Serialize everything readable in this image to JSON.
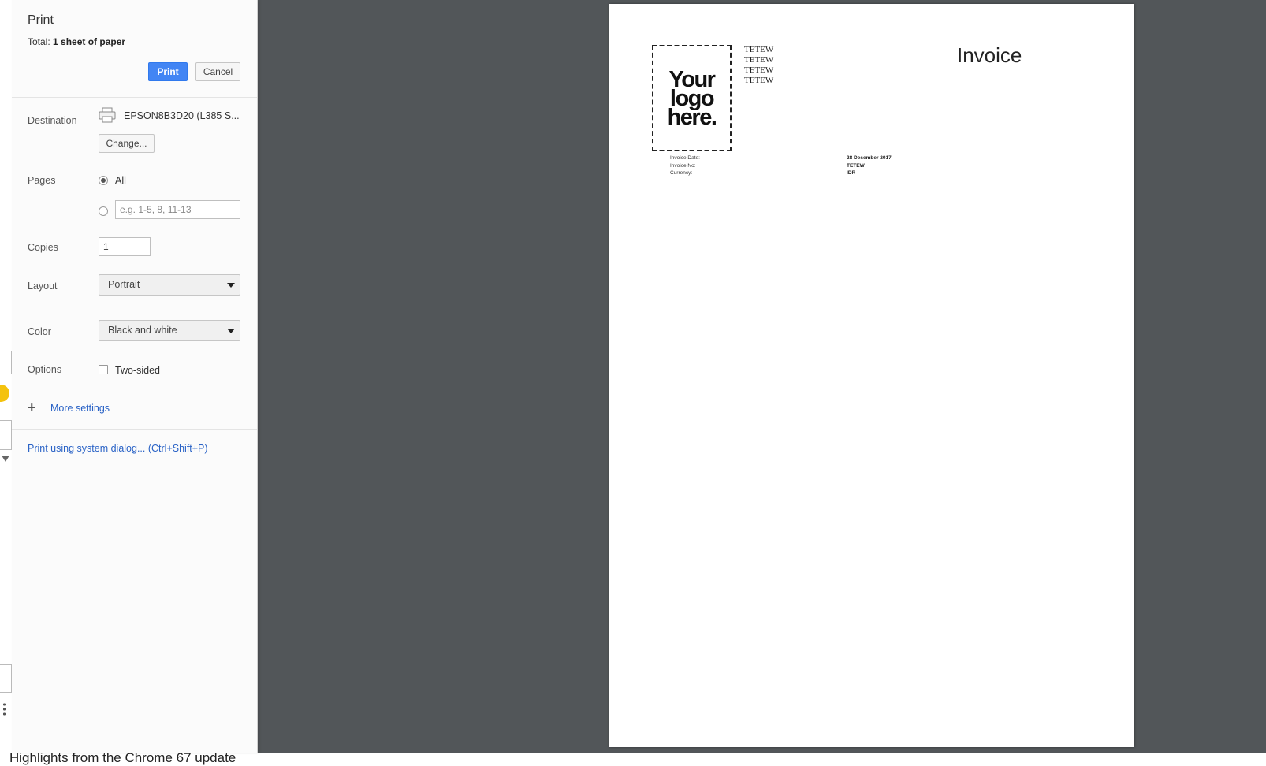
{
  "print_dialog": {
    "title": "Print",
    "total_prefix": "Total: ",
    "total_value": "1 sheet of paper",
    "print_button": "Print",
    "cancel_button": "Cancel",
    "destination": {
      "label": "Destination",
      "printer_name": "EPSON8B3D20 (L385 S...",
      "change_button": "Change..."
    },
    "pages": {
      "label": "Pages",
      "all_option": "All",
      "all_selected": true,
      "range_placeholder": "e.g. 1-5, 8, 11-13",
      "range_value": ""
    },
    "copies": {
      "label": "Copies",
      "value": "1"
    },
    "layout": {
      "label": "Layout",
      "value": "Portrait"
    },
    "color": {
      "label": "Color",
      "value": "Black and white"
    },
    "options": {
      "label": "Options",
      "two_sided_label": "Two-sided",
      "two_sided_checked": false
    },
    "more_settings": "More settings",
    "system_dialog_link": "Print using system dialog... (Ctrl+Shift+P)"
  },
  "preview": {
    "logo_text": "Your logo here.",
    "company_lines": [
      "TETEW",
      "TETEW",
      "TETEW",
      "TETEW"
    ],
    "invoice_title": "Invoice",
    "meta": [
      {
        "label": "Invoice Date:",
        "value": "28 Desember 2017"
      },
      {
        "label": "Invoice No:",
        "value": "TETEW"
      },
      {
        "label": "Currency:",
        "value": "IDR"
      }
    ]
  },
  "background": {
    "caption": "Highlights from the Chrome 67 update"
  },
  "colors": {
    "accent": "#4285f4",
    "preview_background": "#525659",
    "link": "#2962c6"
  }
}
